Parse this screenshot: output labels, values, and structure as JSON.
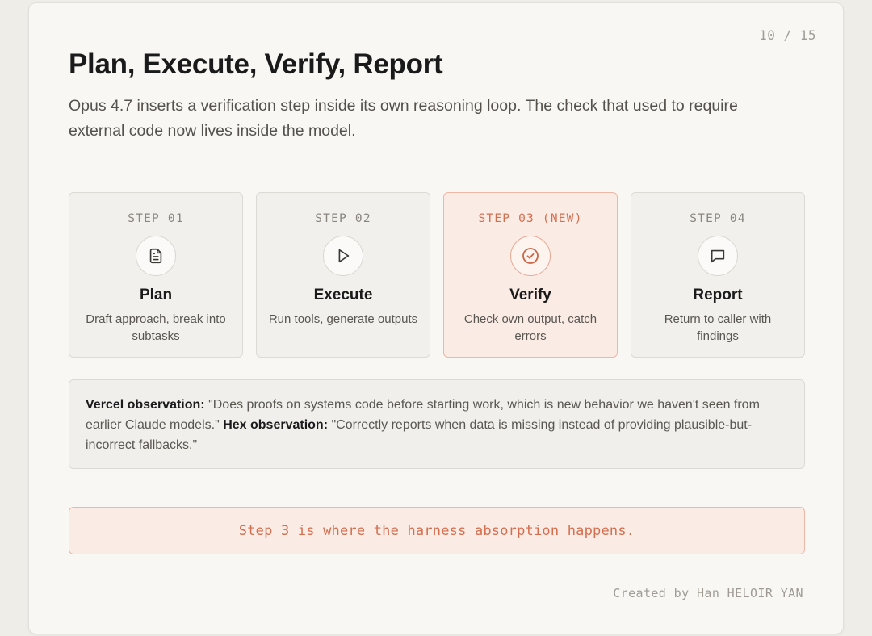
{
  "page_counter": "10 / 15",
  "title": "Plan, Execute, Verify, Report",
  "subtitle": "Opus 4.7 inserts a verification step inside its own reasoning loop. The check that used to require external code now lives inside the model.",
  "steps": [
    {
      "label": "STEP 01",
      "icon": "document-icon",
      "name": "Plan",
      "description": "Draft approach, break into subtasks"
    },
    {
      "label": "STEP 02",
      "icon": "play-icon",
      "name": "Execute",
      "description": "Run tools, generate outputs"
    },
    {
      "label": "STEP 03 (NEW)",
      "icon": "check-circle-icon",
      "name": "Verify",
      "description": "Check own output, catch errors"
    },
    {
      "label": "STEP 04",
      "icon": "message-icon",
      "name": "Report",
      "description": "Return to caller with findings"
    }
  ],
  "observation": {
    "vercel_label": "Vercel observation:",
    "vercel_quote": " \"Does proofs on systems code before starting work, which is new behavior we haven't seen from earlier Claude models.\" ",
    "hex_label": "Hex observation:",
    "hex_quote": " \"Correctly reports when data is missing instead of providing plausible-but-incorrect fallbacks.\""
  },
  "callout": "Step 3 is where the harness absorption happens.",
  "footer": "Created by Han HELOIR YAN",
  "colors": {
    "accent": "#d36f4f",
    "highlight_bg": "#fbebe5",
    "highlight_border": "#eeb7a5",
    "card_bg": "#f1f0ec",
    "slide_bg": "#f8f7f4"
  }
}
